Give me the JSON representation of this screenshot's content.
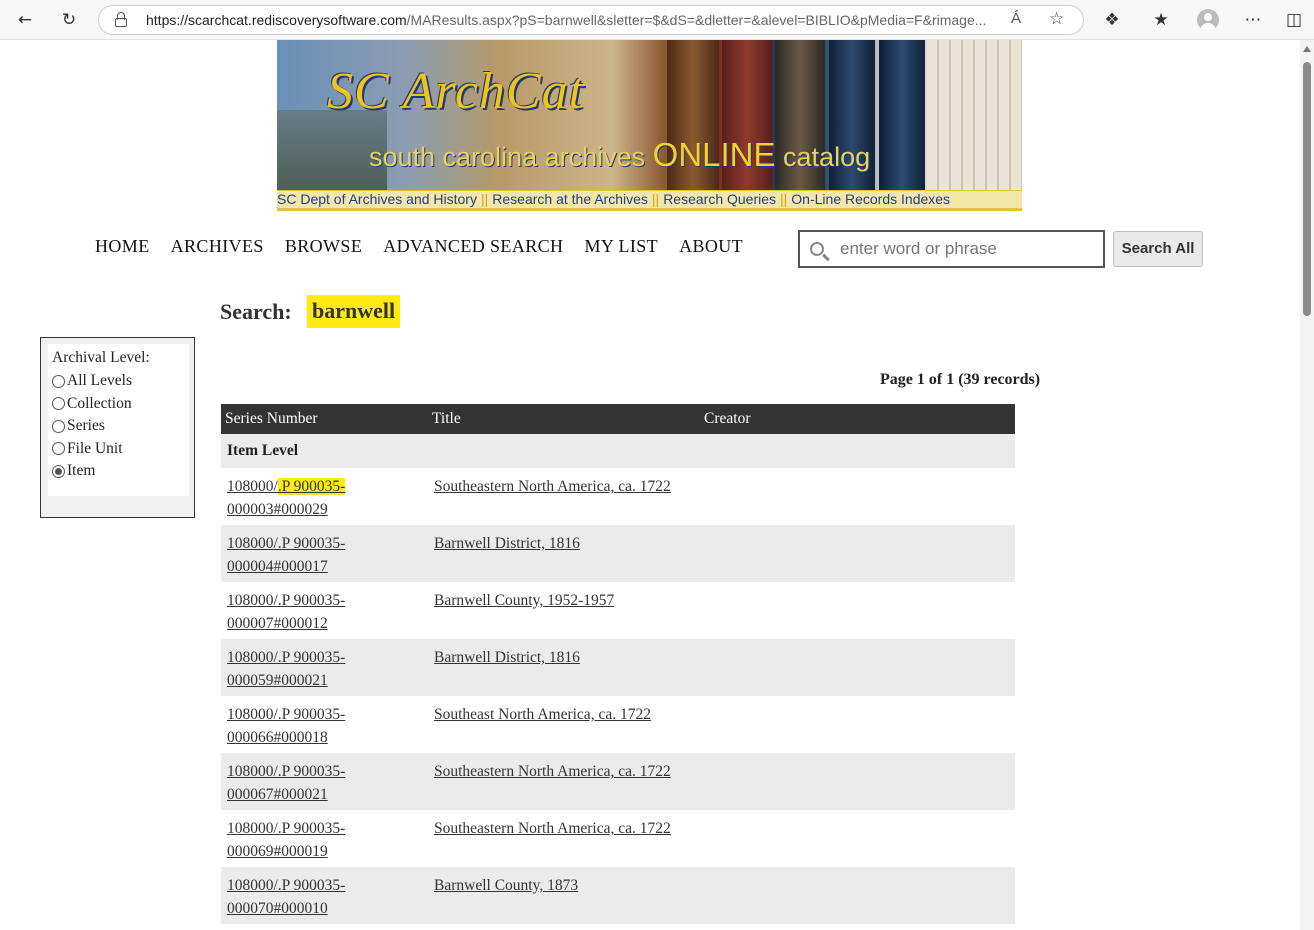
{
  "browser": {
    "url_host": "https://scarchcat.rediscoverysoftware.com",
    "url_path": "/MAResults.aspx?pS=barnwell&sletter=$&dS=&dletter=&alevel=BIBLIO&pMedia=F&rimage...",
    "read_aloud": "Á"
  },
  "banner": {
    "logo": "SC ArchCat",
    "subtitle_pre": "south carolina archives ",
    "subtitle_online": "ONLINE",
    "subtitle_post": " catalog",
    "links": [
      "SC Dept of Archives and History",
      "Research at the Archives",
      "Research Queries",
      "On-Line Records Indexes"
    ]
  },
  "nav": {
    "items": [
      "HOME",
      "ARCHIVES",
      "BROWSE",
      "ADVANCED SEARCH",
      "MY LIST",
      "ABOUT"
    ],
    "search_placeholder": "enter word or phrase",
    "search_button": "Search All"
  },
  "search": {
    "label": "Search:",
    "term": "barnwell"
  },
  "filter": {
    "title": "Archival Level:",
    "options": [
      "All Levels",
      "Collection",
      "Series",
      "File Unit",
      "Item"
    ],
    "selected": "Item"
  },
  "pager": "Page 1 of 1 (39 records)",
  "table": {
    "headers": [
      "Series Number",
      "Title",
      "Creator"
    ],
    "level_label": "Item Level",
    "rows": [
      {
        "series_a": "108000/",
        "series_hl": ".P 900035-",
        "series_b": "000003#000029",
        "title": "Southeastern North America, ca. 1722",
        "creator": ""
      },
      {
        "series_a": "108000/.P 900035-",
        "series_hl": "",
        "series_b": "000004#000017",
        "title": "Barnwell District, 1816",
        "creator": ""
      },
      {
        "series_a": "108000/.P 900035-",
        "series_hl": "",
        "series_b": "000007#000012",
        "title": "Barnwell County, 1952-1957",
        "creator": ""
      },
      {
        "series_a": "108000/.P 900035-",
        "series_hl": "",
        "series_b": "000059#000021",
        "title": "Barnwell District, 1816",
        "creator": ""
      },
      {
        "series_a": "108000/.P 900035-",
        "series_hl": "",
        "series_b": "000066#000018",
        "title": "Southeast North America, ca. 1722",
        "creator": ""
      },
      {
        "series_a": "108000/.P 900035-",
        "series_hl": "",
        "series_b": "000067#000021",
        "title": "Southeastern North America, ca. 1722",
        "creator": ""
      },
      {
        "series_a": "108000/.P 900035-",
        "series_hl": "",
        "series_b": "000069#000019",
        "title": "Southeastern North America, ca. 1722",
        "creator": ""
      },
      {
        "series_a": "108000/.P 900035-",
        "series_hl": "",
        "series_b": "000070#000010",
        "title": "Barnwell County, 1873",
        "creator": ""
      }
    ]
  },
  "colors": {
    "highlight": "#ffeb11",
    "table_header": "#333333",
    "row_alt": "#ebebeb",
    "banner_link": "#1d3e8e"
  }
}
